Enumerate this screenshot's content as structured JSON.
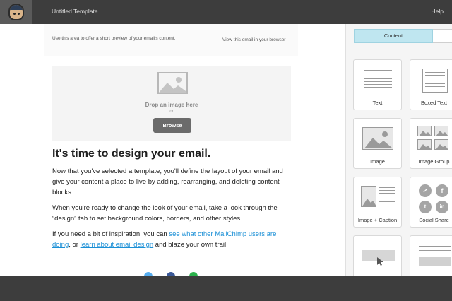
{
  "header": {
    "title": "Untitled Template",
    "help_label": "Help",
    "logo_icon": "chimp-logo-icon"
  },
  "email": {
    "preheader_text": "Use this area to offer a short preview of your email's content.",
    "view_in_browser_link": "View this email in your browser",
    "image_block": {
      "drop_title": "Drop an image here",
      "or_text": "or",
      "browse_label": "Browse"
    },
    "headline": "It's time to design your email.",
    "para1": "Now that you've selected a template, you'll define the layout of your email and give your content a place to live by adding, rearranging, and deleting content blocks.",
    "para2": "When you're ready to change the look of your email, take a look through the “design” tab to set background colors, borders, and other styles.",
    "para3_pre": "If you need a bit of inspiration, you can ",
    "para3_link1": "see what other MailChimp users are doing",
    "para3_mid": ", or ",
    "para3_link2": "learn about email design",
    "para3_post": " and blaze your own trail.",
    "social_icons": [
      {
        "name": "twitter-icon",
        "color": "#55acee"
      },
      {
        "name": "facebook-icon",
        "color": "#3b5998"
      },
      {
        "name": "forward-icon",
        "color": "#2bb24c"
      }
    ]
  },
  "sidebar": {
    "tabs": [
      {
        "label": "Content",
        "active": true
      },
      {
        "label": "",
        "active": false
      }
    ],
    "blocks": [
      {
        "label": "Text",
        "icon": "text-lines-icon"
      },
      {
        "label": "Boxed Text",
        "icon": "boxed-text-icon"
      },
      {
        "label": "Image",
        "icon": "image-icon"
      },
      {
        "label": "Image Group",
        "icon": "image-group-icon"
      },
      {
        "label": "Image + Caption",
        "icon": "image-caption-icon"
      },
      {
        "label": "Social Share",
        "icon": "social-share-icon"
      },
      {
        "label": "",
        "icon": "button-icon"
      },
      {
        "label": "",
        "icon": "divider-block-icon"
      }
    ]
  },
  "colors": {
    "accent_tab": "#bfe6f0",
    "link": "#1a8fd6",
    "chrome": "#3d3d3d"
  }
}
